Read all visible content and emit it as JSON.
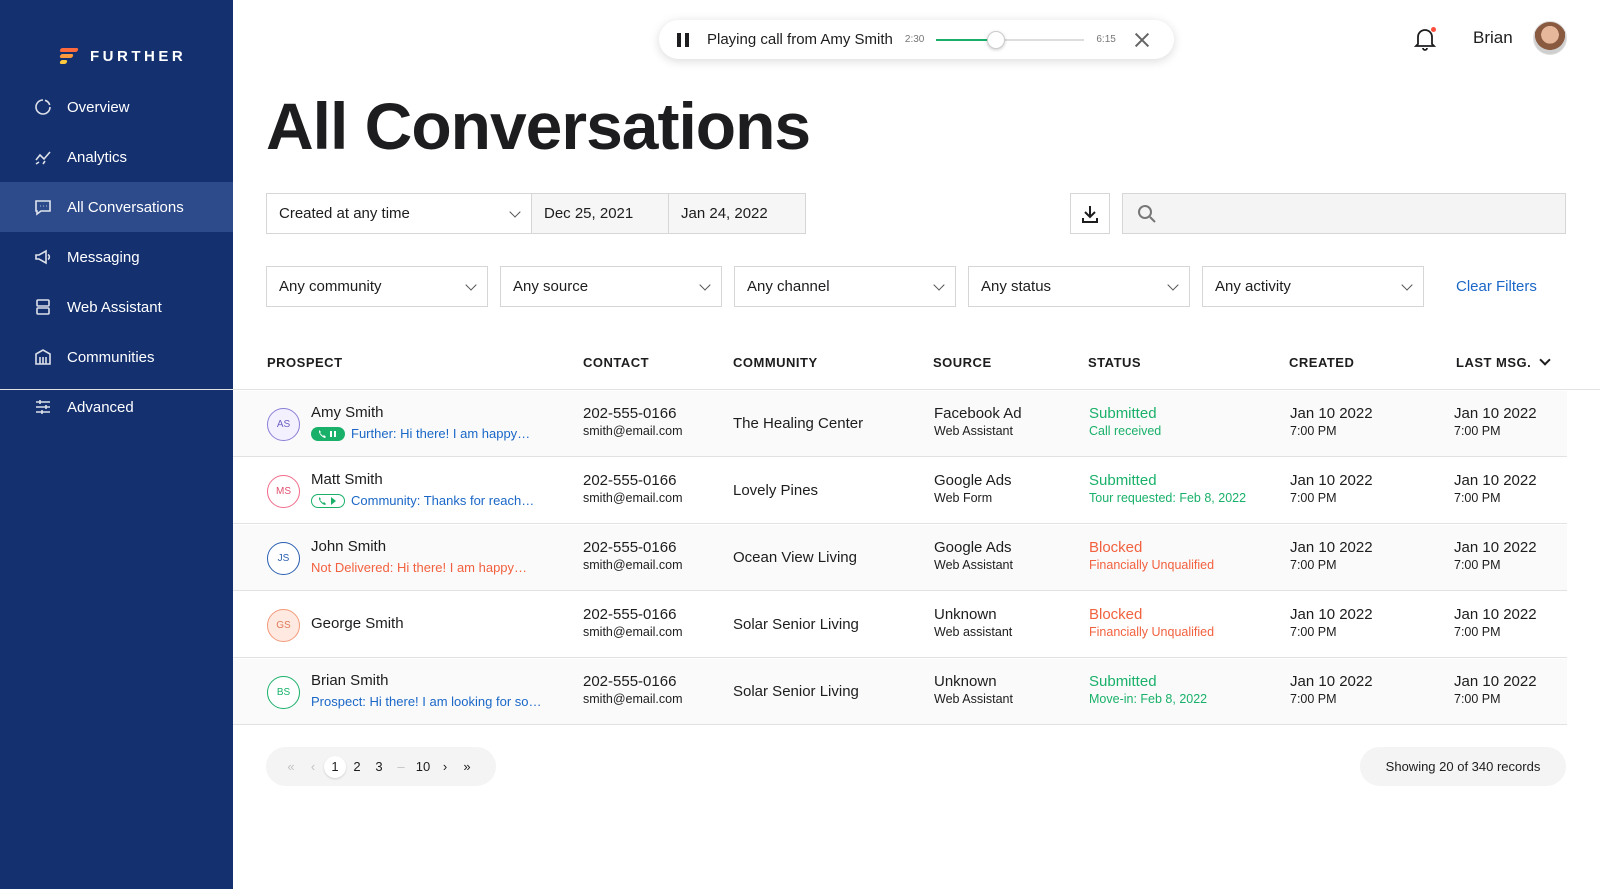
{
  "brand": {
    "name": "FURTHER"
  },
  "sidebar": {
    "items": [
      {
        "label": "Overview",
        "icon": "overview-icon"
      },
      {
        "label": "Analytics",
        "icon": "analytics-icon"
      },
      {
        "label": "All Conversations",
        "icon": "conversations-icon",
        "active": true
      },
      {
        "label": "Messaging",
        "icon": "megaphone-icon"
      },
      {
        "label": "Web Assistant",
        "icon": "web-assistant-icon"
      },
      {
        "label": "Communities",
        "icon": "building-icon"
      },
      {
        "label": "Advanced",
        "icon": "sliders-icon"
      }
    ]
  },
  "player": {
    "text": "Playing call from Amy Smith",
    "elapsed": "2:30",
    "duration": "6:15",
    "progress": 0.4
  },
  "header": {
    "user_name": "Brian"
  },
  "page": {
    "title": "All Conversations"
  },
  "date_filter": {
    "range_label": "Created at any time",
    "start": "Dec 25, 2021",
    "end": "Jan 24, 2022"
  },
  "search": {
    "placeholder": ""
  },
  "filters": {
    "community": "Any community",
    "source": "Any source",
    "channel": "Any channel",
    "status": "Any status",
    "activity": "Any activity",
    "clear_label": "Clear Filters"
  },
  "table": {
    "headers": {
      "prospect": "PROSPECT",
      "contact": "CONTACT",
      "community": "COMMUNITY",
      "source": "SOURCE",
      "status": "STATUS",
      "created": "CREATED",
      "last_msg": "LAST MSG."
    },
    "rows": [
      {
        "initials": "AS",
        "name": "Amy Smith",
        "preview": "Further: Hi there! I am happy…",
        "phone": "202-555-0166",
        "email": "smith@email.com",
        "community": "The Healing Center",
        "source": "Facebook Ad",
        "source_sub": "Web Assistant",
        "status": "Submitted",
        "status_sub": "Call received",
        "created_date": "Jan 10 2022",
        "created_time": "7:00 PM",
        "last_date": "Jan 10 2022",
        "last_time": "7:00 PM"
      },
      {
        "initials": "MS",
        "name": "Matt Smith",
        "preview": "Community: Thanks for reach…",
        "phone": "202-555-0166",
        "email": "smith@email.com",
        "community": "Lovely Pines",
        "source": "Google Ads",
        "source_sub": "Web Form",
        "status": "Submitted",
        "status_sub": "Tour requested: Feb 8, 2022",
        "created_date": "Jan 10 2022",
        "created_time": "7:00 PM",
        "last_date": "Jan 10 2022",
        "last_time": "7:00 PM"
      },
      {
        "initials": "JS",
        "name": "John Smith",
        "preview": "Not Delivered: Hi there! I am happy…",
        "phone": "202-555-0166",
        "email": "smith@email.com",
        "community": "Ocean View Living",
        "source": "Google Ads",
        "source_sub": "Web Assistant",
        "status": "Blocked",
        "status_sub": "Financially Unqualified",
        "created_date": "Jan 10 2022",
        "created_time": "7:00 PM",
        "last_date": "Jan 10 2022",
        "last_time": "7:00 PM"
      },
      {
        "initials": "GS",
        "name": "George Smith",
        "preview": "",
        "phone": "202-555-0166",
        "email": "smith@email.com",
        "community": "Solar Senior Living",
        "source": "Unknown",
        "source_sub": "Web assistant",
        "status": "Blocked",
        "status_sub": "Financially Unqualified",
        "created_date": "Jan 10 2022",
        "created_time": "7:00 PM",
        "last_date": "Jan 10 2022",
        "last_time": "7:00 PM"
      },
      {
        "initials": "BS",
        "name": "Brian Smith",
        "preview": "Prospect: Hi there! I am looking for so…",
        "phone": "202-555-0166",
        "email": "smith@email.com",
        "community": "Solar Senior Living",
        "source": "Unknown",
        "source_sub": "Web Assistant",
        "status": "Submitted",
        "status_sub": "Move-in: Feb 8, 2022",
        "created_date": "Jan 10 2022",
        "created_time": "7:00 PM",
        "last_date": "Jan 10 2022",
        "last_time": "7:00 PM"
      }
    ]
  },
  "pagination": {
    "first": "«",
    "prev": "‹",
    "pages": [
      "1",
      "2",
      "3"
    ],
    "ellipsis": "–",
    "last_page": "10",
    "next": "›",
    "last": "»",
    "records_text": "Showing 20 of 340 records"
  },
  "colors": {
    "sidebar_bg": "#14306f",
    "sidebar_active": "#2d4a8a",
    "accent_blue": "#1a67c7",
    "success_green": "#19b16a",
    "danger_orange": "#f2613f"
  }
}
